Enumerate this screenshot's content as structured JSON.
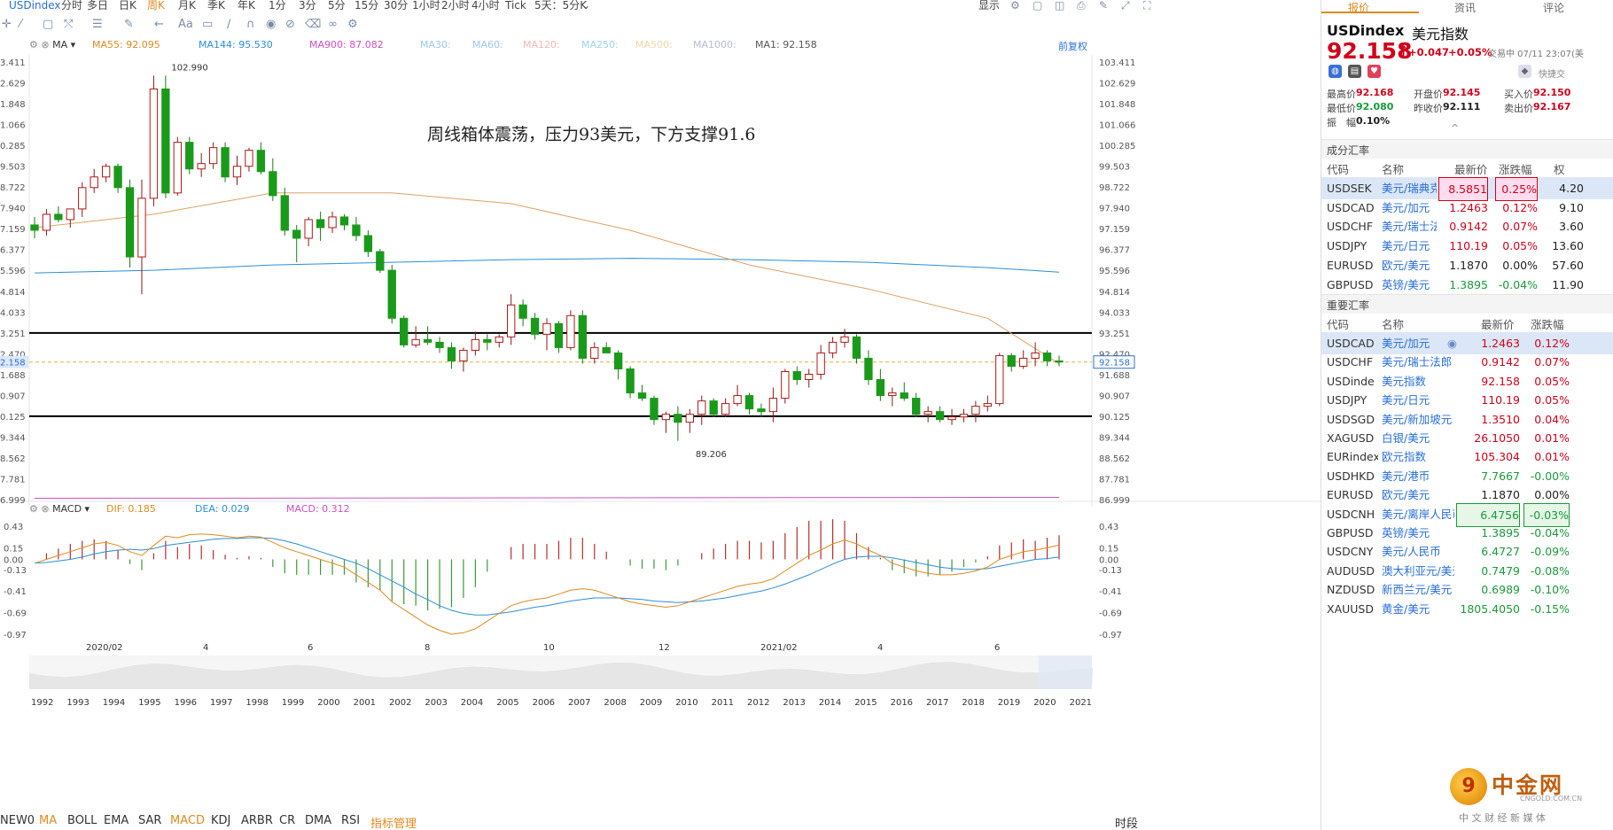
{
  "toolbar": {
    "symbol": "USDindex",
    "periods": [
      "分时",
      "多日",
      "日K",
      "周K",
      "月K",
      "季K",
      "年K",
      "1分",
      "3分",
      "5分",
      "15分",
      "30分",
      "1小时",
      "2小时",
      "4小时",
      "Tick",
      "5天：5分K"
    ],
    "active_period": "周K",
    "right_items": [
      "显示"
    ]
  },
  "ma_legend": {
    "name": "MA",
    "items": [
      {
        "label": "MA55: 92.095",
        "color": "#e08a1e"
      },
      {
        "label": "MA144: 95.530",
        "color": "#2a8fd6"
      },
      {
        "label": "MA900: 87.082",
        "color": "#d050c0"
      },
      {
        "label": "MA30:",
        "color": "#9cc6ef"
      },
      {
        "label": "MA60:",
        "color": "#9cc6ef"
      },
      {
        "label": "MA120:",
        "color": "#f4b6b6"
      },
      {
        "label": "MA250:",
        "color": "#9cd3ef"
      },
      {
        "label": "MA500:",
        "color": "#f4d5a6"
      },
      {
        "label": "MA1000:",
        "color": "#b8b8d8"
      },
      {
        "label": "MA1: 92.158",
        "color": "#555555"
      }
    ],
    "adjust": "前复权"
  },
  "annotation": "周线箱体震荡，压力93美元，下方支撑91.6",
  "macd_legend": {
    "name": "MACD",
    "items": [
      {
        "label": "DIF: 0.185",
        "color": "#e08a1e"
      },
      {
        "label": "DEA: 0.029",
        "color": "#2a8fd6"
      },
      {
        "label": "MACD: 0.312",
        "color": "#d050c0"
      }
    ]
  },
  "chart_data": {
    "type": "candlestick",
    "price_axis": [
      "103.411",
      "102.629",
      "101.848",
      "101.066",
      "100.285",
      "99.503",
      "98.722",
      "97.940",
      "97.159",
      "96.377",
      "95.596",
      "94.814",
      "94.033",
      "93.251",
      "92.470",
      "91.688",
      "90.907",
      "90.125",
      "89.344",
      "88.562",
      "87.781",
      "86.999"
    ],
    "price_axis_left": [
      "3.411",
      "2.629",
      "1.848",
      "1.066",
      "0.285",
      "9.503",
      "8.722",
      "7.940",
      "7.159",
      "6.377",
      "5.596",
      "4.814",
      "4.033",
      "3.251",
      "2.470",
      "1.688",
      "0.907",
      "0.125",
      "9.344",
      "8.562",
      "7.781",
      "6.999"
    ],
    "ylim": [
      86.999,
      103.411
    ],
    "current_price": "92.158",
    "current_price_left": "2.158",
    "high_label": "102.990",
    "low_label": "89.206",
    "resistance": 93.251,
    "support": 90.125,
    "x_labels": [
      "2020/02",
      "4",
      "6",
      "8",
      "10",
      "12",
      "2021/02",
      "4",
      "6"
    ],
    "candles": [
      [
        97.3,
        97.6,
        96.8,
        97.1
      ],
      [
        97.1,
        97.9,
        96.9,
        97.7
      ],
      [
        97.7,
        98.0,
        97.4,
        97.5
      ],
      [
        97.5,
        97.7,
        97.2,
        97.9
      ],
      [
        97.9,
        98.9,
        97.6,
        98.7
      ],
      [
        98.7,
        99.4,
        98.5,
        99.1
      ],
      [
        99.1,
        99.6,
        98.9,
        99.5
      ],
      [
        99.5,
        99.6,
        98.5,
        98.7
      ],
      [
        98.7,
        99.0,
        95.7,
        96.1
      ],
      [
        96.1,
        99.0,
        94.7,
        98.3
      ],
      [
        98.3,
        102.9,
        98.0,
        102.4
      ],
      [
        102.4,
        102.9,
        98.3,
        98.5
      ],
      [
        98.5,
        100.6,
        98.4,
        100.4
      ],
      [
        100.4,
        100.6,
        99.2,
        99.4
      ],
      [
        99.4,
        100.0,
        99.1,
        99.6
      ],
      [
        99.6,
        100.4,
        99.4,
        100.2
      ],
      [
        100.2,
        100.4,
        98.9,
        99.1
      ],
      [
        99.1,
        99.9,
        98.8,
        99.5
      ],
      [
        99.5,
        100.2,
        99.3,
        100.1
      ],
      [
        100.1,
        100.4,
        99.2,
        99.3
      ],
      [
        99.3,
        99.8,
        98.2,
        98.4
      ],
      [
        98.4,
        98.7,
        96.9,
        97.1
      ],
      [
        97.1,
        97.3,
        95.9,
        96.8
      ],
      [
        96.8,
        97.6,
        96.5,
        97.5
      ],
      [
        97.5,
        97.8,
        96.7,
        97.2
      ],
      [
        97.2,
        97.8,
        97.0,
        97.6
      ],
      [
        97.6,
        97.7,
        97.1,
        97.3
      ],
      [
        97.3,
        97.6,
        96.7,
        96.9
      ],
      [
        96.9,
        97.1,
        96.1,
        96.3
      ],
      [
        96.3,
        96.4,
        95.5,
        95.6
      ],
      [
        95.6,
        95.8,
        93.6,
        93.8
      ],
      [
        93.8,
        93.9,
        92.7,
        92.8
      ],
      [
        92.8,
        93.5,
        92.7,
        93.0
      ],
      [
        93.0,
        93.5,
        92.8,
        92.9
      ],
      [
        92.9,
        93.1,
        92.5,
        92.7
      ],
      [
        92.7,
        92.9,
        91.9,
        92.2
      ],
      [
        92.2,
        92.7,
        91.8,
        92.6
      ],
      [
        92.6,
        93.3,
        92.4,
        93.0
      ],
      [
        93.0,
        93.2,
        92.6,
        92.9
      ],
      [
        92.9,
        93.2,
        92.7,
        93.1
      ],
      [
        93.1,
        94.7,
        92.8,
        94.3
      ],
      [
        94.3,
        94.5,
        93.5,
        93.8
      ],
      [
        93.8,
        94.0,
        93.0,
        93.2
      ],
      [
        93.2,
        93.8,
        92.6,
        93.6
      ],
      [
        93.6,
        93.7,
        92.5,
        92.7
      ],
      [
        92.7,
        94.1,
        92.6,
        93.9
      ],
      [
        93.9,
        94.1,
        92.1,
        92.3
      ],
      [
        92.3,
        92.9,
        92.1,
        92.7
      ],
      [
        92.7,
        92.9,
        92.5,
        92.5
      ],
      [
        92.5,
        92.6,
        91.5,
        91.9
      ],
      [
        91.9,
        92.0,
        90.8,
        91.0
      ],
      [
        91.0,
        91.3,
        90.7,
        90.8
      ],
      [
        90.8,
        90.9,
        89.8,
        90.0
      ],
      [
        90.0,
        90.3,
        89.5,
        90.2
      ],
      [
        90.2,
        90.5,
        89.2,
        89.9
      ],
      [
        89.9,
        90.4,
        89.5,
        90.2
      ],
      [
        90.2,
        90.9,
        89.8,
        90.7
      ],
      [
        90.7,
        90.8,
        90.1,
        90.2
      ],
      [
        90.2,
        90.8,
        90.1,
        90.6
      ],
      [
        90.6,
        91.3,
        90.5,
        90.9
      ],
      [
        90.9,
        91.0,
        90.2,
        90.4
      ],
      [
        90.4,
        90.6,
        90.1,
        90.3
      ],
      [
        90.3,
        91.2,
        89.9,
        90.8
      ],
      [
        90.8,
        91.9,
        90.6,
        91.8
      ],
      [
        91.8,
        92.0,
        91.3,
        91.5
      ],
      [
        91.5,
        91.9,
        91.2,
        91.7
      ],
      [
        91.7,
        92.8,
        91.5,
        92.5
      ],
      [
        92.5,
        93.1,
        92.3,
        92.9
      ],
      [
        92.9,
        93.4,
        92.7,
        93.1
      ],
      [
        93.1,
        93.2,
        92.1,
        92.3
      ],
      [
        92.3,
        92.6,
        91.3,
        91.5
      ],
      [
        91.5,
        91.9,
        90.7,
        90.9
      ],
      [
        90.9,
        91.2,
        90.5,
        91.0
      ],
      [
        91.0,
        91.4,
        90.7,
        90.8
      ],
      [
        90.8,
        91.0,
        90.1,
        90.2
      ],
      [
        90.2,
        90.5,
        89.9,
        90.3
      ],
      [
        90.3,
        90.5,
        89.9,
        90.0
      ],
      [
        90.0,
        90.4,
        89.8,
        90.1
      ],
      [
        90.1,
        90.4,
        89.9,
        90.2
      ],
      [
        90.2,
        90.7,
        89.9,
        90.5
      ],
      [
        90.5,
        90.9,
        90.3,
        90.6
      ],
      [
        90.6,
        92.5,
        90.5,
        92.4
      ],
      [
        92.4,
        92.5,
        91.8,
        92.0
      ],
      [
        92.0,
        92.6,
        91.9,
        92.3
      ],
      [
        92.3,
        92.9,
        92.0,
        92.5
      ],
      [
        92.5,
        92.6,
        92.0,
        92.2
      ],
      [
        92.2,
        92.4,
        92.0,
        92.158
      ]
    ],
    "ma55": [
      [
        0,
        97.2
      ],
      [
        10,
        97.7
      ],
      [
        20,
        98.5
      ],
      [
        30,
        98.5
      ],
      [
        40,
        98.1
      ],
      [
        50,
        97.1
      ],
      [
        60,
        95.8
      ],
      [
        70,
        94.9
      ],
      [
        80,
        93.8
      ],
      [
        86,
        92.095
      ]
    ],
    "ma144": [
      [
        0,
        95.5
      ],
      [
        10,
        95.6
      ],
      [
        20,
        95.8
      ],
      [
        30,
        95.9
      ],
      [
        40,
        96.0
      ],
      [
        50,
        96.05
      ],
      [
        60,
        96.0
      ],
      [
        70,
        95.9
      ],
      [
        80,
        95.7
      ],
      [
        86,
        95.53
      ]
    ],
    "ma900": [
      [
        0,
        87.05
      ],
      [
        86,
        87.082
      ]
    ],
    "macd_axis_right": [
      "0.43",
      "0.15",
      "0.00",
      "-0.13",
      "-0.41",
      "-0.69",
      "-0.97"
    ],
    "macd_axis_left": [
      "0.43",
      "0.15",
      "0.00",
      "-0.13",
      "-0.41",
      "-0.69",
      "-0.97"
    ],
    "macd_ylim": [
      -0.97,
      0.43
    ],
    "dif": [
      -0.05,
      0.0,
      0.05,
      0.1,
      0.15,
      0.2,
      0.22,
      0.18,
      0.1,
      0.05,
      0.18,
      0.3,
      0.28,
      0.32,
      0.33,
      0.32,
      0.3,
      0.28,
      0.3,
      0.29,
      0.22,
      0.15,
      0.1,
      0.05,
      0.0,
      -0.05,
      -0.1,
      -0.2,
      -0.3,
      -0.4,
      -0.55,
      -0.65,
      -0.75,
      -0.85,
      -0.92,
      -0.97,
      -0.95,
      -0.9,
      -0.8,
      -0.7,
      -0.6,
      -0.55,
      -0.52,
      -0.5,
      -0.45,
      -0.4,
      -0.38,
      -0.4,
      -0.45,
      -0.5,
      -0.55,
      -0.58,
      -0.6,
      -0.62,
      -0.6,
      -0.55,
      -0.5,
      -0.45,
      -0.4,
      -0.35,
      -0.32,
      -0.3,
      -0.25,
      -0.15,
      -0.05,
      0.05,
      0.12,
      0.2,
      0.25,
      0.2,
      0.12,
      0.05,
      -0.05,
      -0.1,
      -0.15,
      -0.18,
      -0.2,
      -0.2,
      -0.18,
      -0.15,
      -0.1,
      0.0,
      0.05,
      0.1,
      0.12,
      0.15,
      0.185
    ],
    "dea": [
      -0.05,
      -0.04,
      -0.02,
      0.0,
      0.03,
      0.07,
      0.1,
      0.12,
      0.13,
      0.12,
      0.14,
      0.18,
      0.2,
      0.22,
      0.24,
      0.26,
      0.27,
      0.27,
      0.28,
      0.28,
      0.27,
      0.24,
      0.2,
      0.15,
      0.1,
      0.05,
      0.0,
      -0.05,
      -0.12,
      -0.2,
      -0.28,
      -0.36,
      -0.45,
      -0.52,
      -0.6,
      -0.66,
      -0.7,
      -0.72,
      -0.72,
      -0.7,
      -0.68,
      -0.65,
      -0.62,
      -0.6,
      -0.57,
      -0.54,
      -0.52,
      -0.5,
      -0.5,
      -0.5,
      -0.51,
      -0.52,
      -0.54,
      -0.55,
      -0.56,
      -0.55,
      -0.54,
      -0.52,
      -0.5,
      -0.47,
      -0.44,
      -0.41,
      -0.37,
      -0.32,
      -0.26,
      -0.2,
      -0.13,
      -0.06,
      0.0,
      0.03,
      0.04,
      0.04,
      0.02,
      -0.01,
      -0.04,
      -0.07,
      -0.1,
      -0.12,
      -0.13,
      -0.13,
      -0.12,
      -0.09,
      -0.06,
      -0.03,
      0.0,
      0.01,
      0.029
    ]
  },
  "timeline_years": [
    "1992",
    "1993",
    "1994",
    "1995",
    "1996",
    "1997",
    "1998",
    "1999",
    "2000",
    "2001",
    "2002",
    "2003",
    "2004",
    "2005",
    "2006",
    "2007",
    "2008",
    "2009",
    "2010",
    "2011",
    "2012",
    "2013",
    "2014",
    "2015",
    "2016",
    "2017",
    "2018",
    "2019",
    "2020",
    "2021"
  ],
  "bottom_tabs": [
    "NEW0",
    "MA",
    "BOLL",
    "EMA",
    "SAR",
    "MACD",
    "KDJ",
    "ARBR",
    "CR",
    "DMA",
    "RSI",
    "指标管理"
  ],
  "bottom_active": [
    "MA",
    "MACD"
  ],
  "bottom_right": "时段",
  "panel": {
    "tabs": [
      "报价",
      "资讯",
      "评论"
    ],
    "symbol": "USDindex",
    "name": "美元指数",
    "price": "92.158",
    "change": "+0.047",
    "change_pct": "+0.05%",
    "trade_time": "交易中 07/11 23:07(美",
    "quick": "快捷交",
    "stats": [
      {
        "label": "最高价",
        "value": "92.168",
        "color": "red"
      },
      {
        "label": "开盘价",
        "value": "92.145",
        "color": "red"
      },
      {
        "label": "买入价",
        "value": "92.150",
        "color": "red"
      },
      {
        "label": "最低价",
        "value": "92.080",
        "color": "green"
      },
      {
        "label": "昨收价",
        "value": "92.111",
        "color": "dark"
      },
      {
        "label": "卖出价",
        "value": "92.167",
        "color": "red"
      },
      {
        "label": "振　幅",
        "value": "0.10%",
        "color": "dark"
      }
    ],
    "section1": "成分汇率",
    "t1_headers": [
      "代码",
      "名称",
      "最新价",
      "涨跌幅",
      "权"
    ],
    "t1_rows": [
      {
        "code": "USDSEK",
        "name": "美元/瑞典克",
        "price": "8.5851",
        "pct": "0.25%",
        "w": "4.20",
        "c": "red",
        "sel": true
      },
      {
        "code": "USDCAD",
        "name": "美元/加元",
        "price": "1.2463",
        "pct": "0.12%",
        "w": "9.10",
        "c": "red"
      },
      {
        "code": "USDCHF",
        "name": "美元/瑞士法",
        "price": "0.9142",
        "pct": "0.07%",
        "w": "3.60",
        "c": "red"
      },
      {
        "code": "USDJPY",
        "name": "美元/日元",
        "price": "110.19",
        "pct": "0.05%",
        "w": "13.60",
        "c": "red"
      },
      {
        "code": "EURUSD",
        "name": "欧元/美元",
        "price": "1.1870",
        "pct": "0.00%",
        "w": "57.60",
        "c": "dark"
      },
      {
        "code": "GBPUSD",
        "name": "英镑/美元",
        "price": "1.3895",
        "pct": "-0.04%",
        "w": "11.90",
        "c": "green"
      }
    ],
    "section2": "重要汇率",
    "t2_headers": [
      "代码",
      "名称",
      "最新价",
      "涨跌幅"
    ],
    "t2_rows": [
      {
        "code": "USDCAD",
        "name": "美元/加元",
        "price": "1.2463",
        "pct": "0.12%",
        "c": "red",
        "sel": true
      },
      {
        "code": "USDCHF",
        "name": "美元/瑞士法郎",
        "price": "0.9142",
        "pct": "0.07%",
        "c": "red"
      },
      {
        "code": "USDinde",
        "name": "美元指数",
        "price": "92.158",
        "pct": "0.05%",
        "c": "red"
      },
      {
        "code": "USDJPY",
        "name": "美元/日元",
        "price": "110.19",
        "pct": "0.05%",
        "c": "red"
      },
      {
        "code": "USDSGD",
        "name": "美元/新加坡元",
        "price": "1.3510",
        "pct": "0.04%",
        "c": "red"
      },
      {
        "code": "XAGUSD",
        "name": "白银/美元",
        "price": "26.1050",
        "pct": "0.01%",
        "c": "red"
      },
      {
        "code": "EURindex",
        "name": "欧元指数",
        "price": "105.304",
        "pct": "0.01%",
        "c": "red"
      },
      {
        "code": "USDHKD",
        "name": "美元/港币",
        "price": "7.7667",
        "pct": "-0.00%",
        "c": "green"
      },
      {
        "code": "EURUSD",
        "name": "欧元/美元",
        "price": "1.1870",
        "pct": "0.00%",
        "c": "dark"
      },
      {
        "code": "USDCNH",
        "name": "美元/离岸人民币",
        "price": "6.4756",
        "pct": "-0.03%",
        "c": "green",
        "box": true
      },
      {
        "code": "GBPUSD",
        "name": "英镑/美元",
        "price": "1.3895",
        "pct": "-0.04%",
        "c": "green"
      },
      {
        "code": "USDCNY",
        "name": "美元/人民币",
        "price": "6.4727",
        "pct": "-0.09%",
        "c": "green"
      },
      {
        "code": "AUDUSD",
        "name": "澳大利亚元/美元",
        "price": "0.7479",
        "pct": "-0.08%",
        "c": "green"
      },
      {
        "code": "NZDUSD",
        "name": "新西兰元/美元",
        "price": "0.6989",
        "pct": "-0.10%",
        "c": "green"
      },
      {
        "code": "XAUUSD",
        "name": "黄金/美元",
        "price": "1805.4050",
        "pct": "-0.15%",
        "c": "green"
      }
    ],
    "watermark_name": "中金网",
    "watermark_site": "CNGOLD.COM.CN",
    "watermark_slogan": "中 文 财 经 新 媒 体"
  }
}
